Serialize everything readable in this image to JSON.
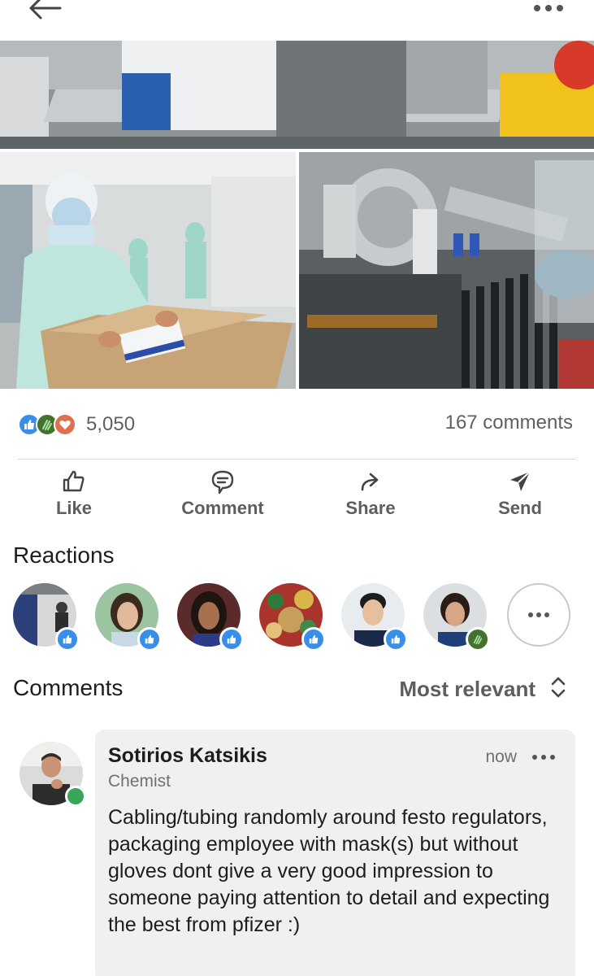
{
  "post": {
    "reactions_count": "5,050",
    "comments_count": "167 comments",
    "reaction_types": [
      "like-icon",
      "celebrate-icon",
      "love-icon"
    ]
  },
  "actions": {
    "like": "Like",
    "comment": "Comment",
    "share": "Share",
    "send": "Send"
  },
  "reactions_section": {
    "title": "Reactions",
    "reactors": [
      {
        "avatar": "avatar-1",
        "reaction": "like-icon"
      },
      {
        "avatar": "avatar-2",
        "reaction": "like-icon"
      },
      {
        "avatar": "avatar-3",
        "reaction": "like-icon"
      },
      {
        "avatar": "avatar-4",
        "reaction": "like-icon"
      },
      {
        "avatar": "avatar-5",
        "reaction": "like-icon"
      },
      {
        "avatar": "avatar-6",
        "reaction": "celebrate-icon"
      }
    ]
  },
  "comments_section": {
    "title": "Comments",
    "sort_label": "Most relevant"
  },
  "comment": {
    "author": "Sotirios Katsikis",
    "headline": "Chemist",
    "time": "now",
    "text": "Cabling/tubing randomly around festo regulators, packaging employee with mask(s) but without gloves dont give a very good impression to someone paying attention to detail and expecting the best from pfizer :)"
  },
  "colors": {
    "like": "#378fe9",
    "celebrate": "#44712e",
    "love": "#df704d",
    "online": "#3aa657",
    "muted_text": "#5e5e5e"
  }
}
